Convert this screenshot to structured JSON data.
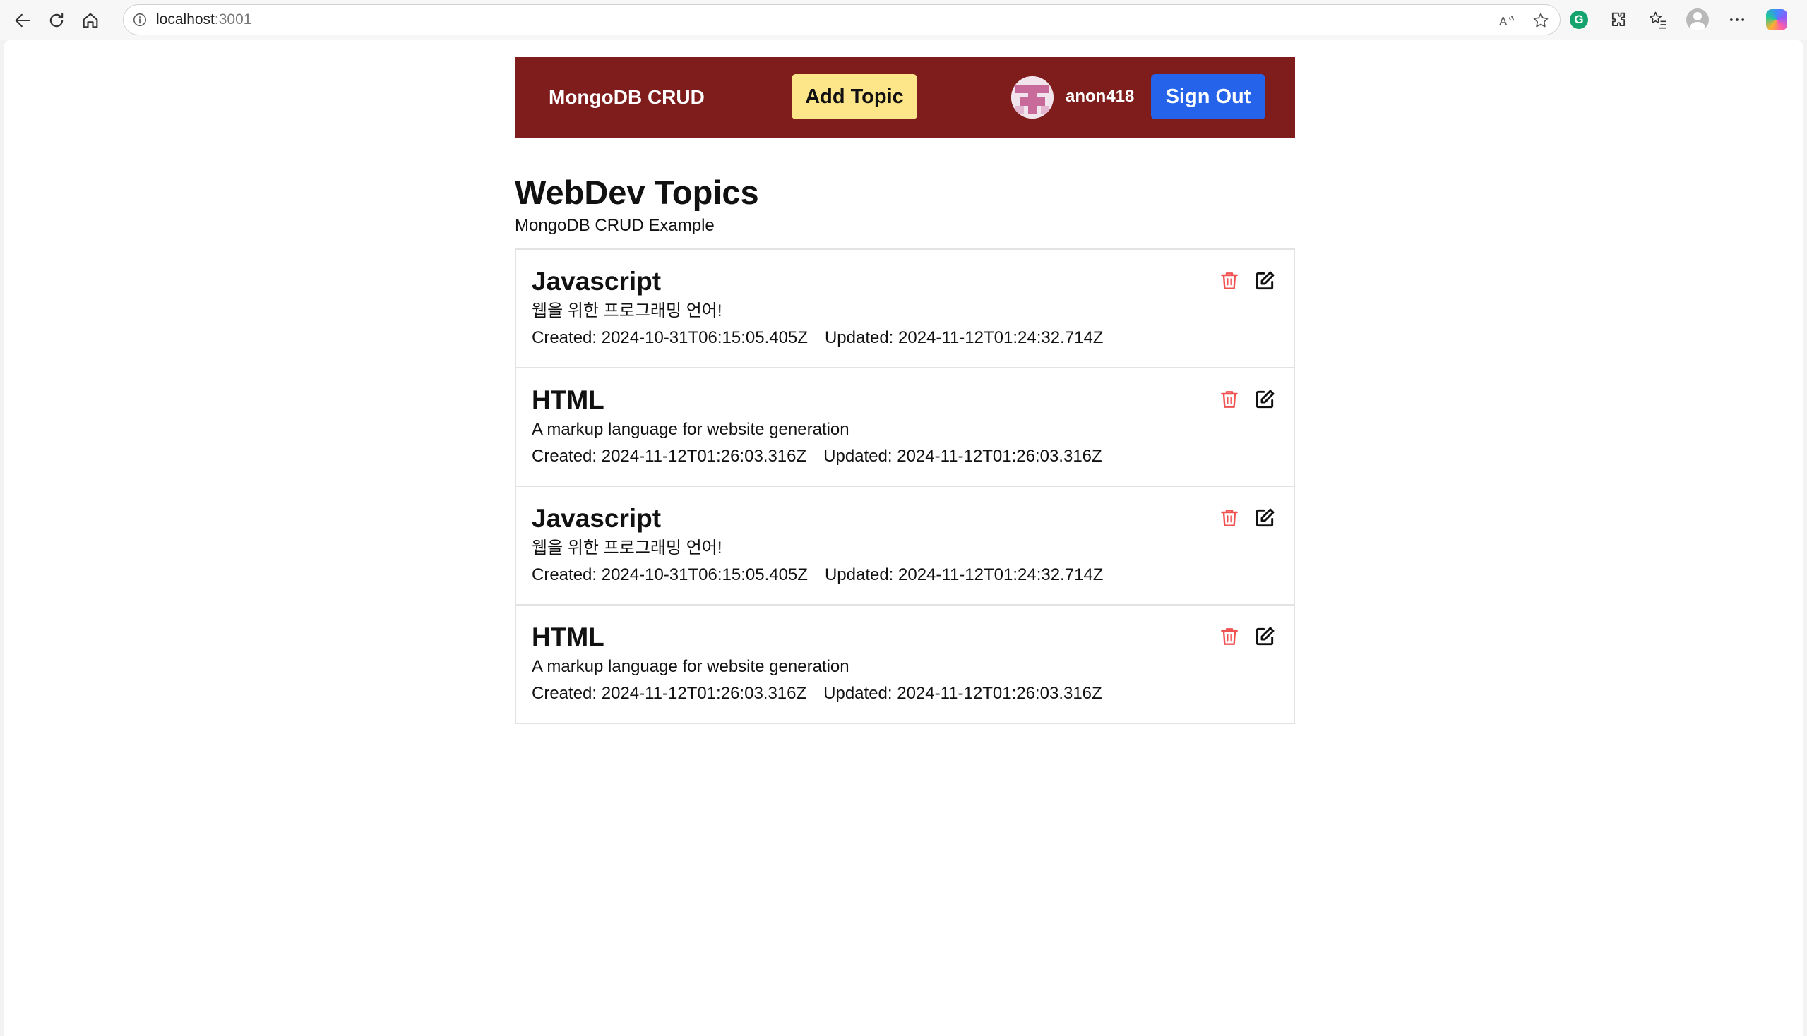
{
  "browser": {
    "url_host": "localhost",
    "url_port": ":3001"
  },
  "navbar": {
    "brand": "MongoDB CRUD",
    "add_topic_label": "Add Topic",
    "username": "anon418",
    "sign_out_label": "Sign Out",
    "colors": {
      "background": "#7f1d1d",
      "add_topic": "#fde68a",
      "sign_out": "#2563eb"
    }
  },
  "page": {
    "title": "WebDev Topics",
    "subtitle": "MongoDB CRUD Example"
  },
  "topics": [
    {
      "title": "Javascript",
      "description": "웹을 위한 프로그래밍 언어!",
      "created": "Created: 2024-10-31T06:15:05.405Z",
      "updated": "Updated: 2024-11-12T01:24:32.714Z"
    },
    {
      "title": "HTML",
      "description": "A markup language for website generation",
      "created": "Created: 2024-11-12T01:26:03.316Z",
      "updated": "Updated: 2024-11-12T01:26:03.316Z"
    },
    {
      "title": "Javascript",
      "description": "웹을 위한 프로그래밍 언어!",
      "created": "Created: 2024-10-31T06:15:05.405Z",
      "updated": "Updated: 2024-11-12T01:24:32.714Z"
    },
    {
      "title": "HTML",
      "description": "A markup language for website generation",
      "created": "Created: 2024-11-12T01:26:03.316Z",
      "updated": "Updated: 2024-11-12T01:26:03.316Z"
    }
  ],
  "icons": {
    "delete": "trash-icon",
    "edit": "edit-icon"
  }
}
